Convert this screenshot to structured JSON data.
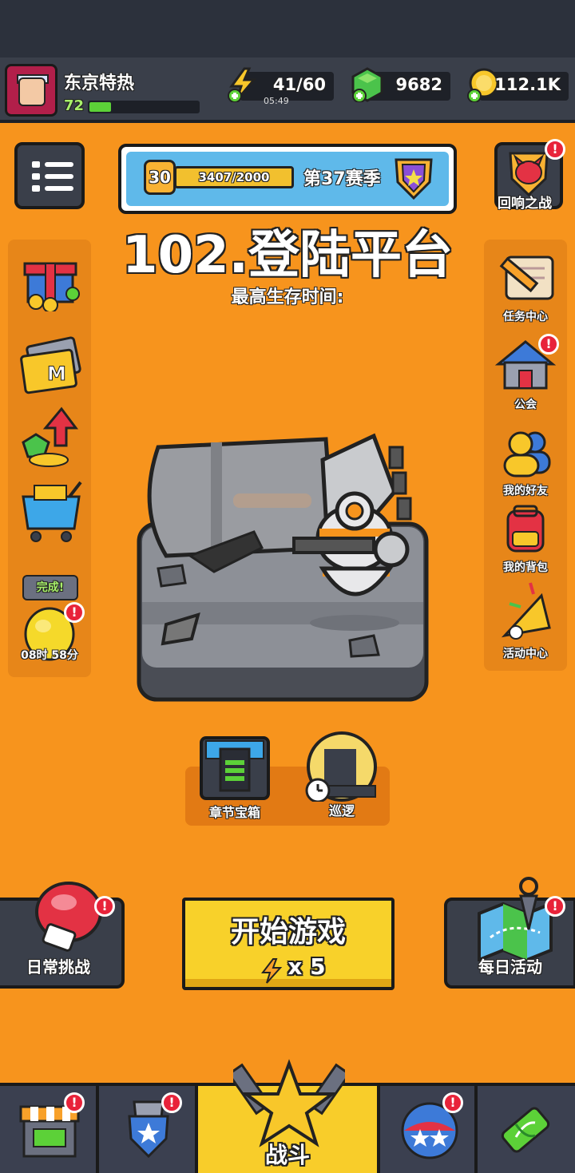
{
  "player": {
    "name": "东京特热",
    "level": "72",
    "xp_fraction": 0.2
  },
  "resources": {
    "energy": {
      "value": "41/60",
      "timer": "05:49",
      "icon": "lightning-icon"
    },
    "gems": {
      "value": "9682",
      "icon": "gem-icon"
    },
    "coins": {
      "value": "112.1K",
      "icon": "coin-icon"
    }
  },
  "season": {
    "level": "30",
    "progress": "3407/2000",
    "label": "第37赛季"
  },
  "level_title": "102.登陆平台",
  "best_survival_label": "最高生存时间:",
  "left_sidebar": {
    "completed_bubble": "完成!",
    "timer": "08时 58分"
  },
  "right_sidebar": {
    "echo_battle": "回响之战",
    "tasks": "任务中心",
    "guild": "公会",
    "friends": "我的好友",
    "backpack": "我的背包",
    "events": "活动中心"
  },
  "chapter": {
    "chest_label": "章节宝箱",
    "patrol_label": "巡逻"
  },
  "actions": {
    "daily_challenge": "日常挑战",
    "start_game": "开始游戏",
    "start_cost": "x 5",
    "daily_event": "每日活动"
  },
  "nav": {
    "battle": "战斗"
  },
  "colors": {
    "background": "#f7941d",
    "accent_yellow": "#f8d12a",
    "badge_red": "#e8233a",
    "panel_dark": "#3a3f4a"
  }
}
